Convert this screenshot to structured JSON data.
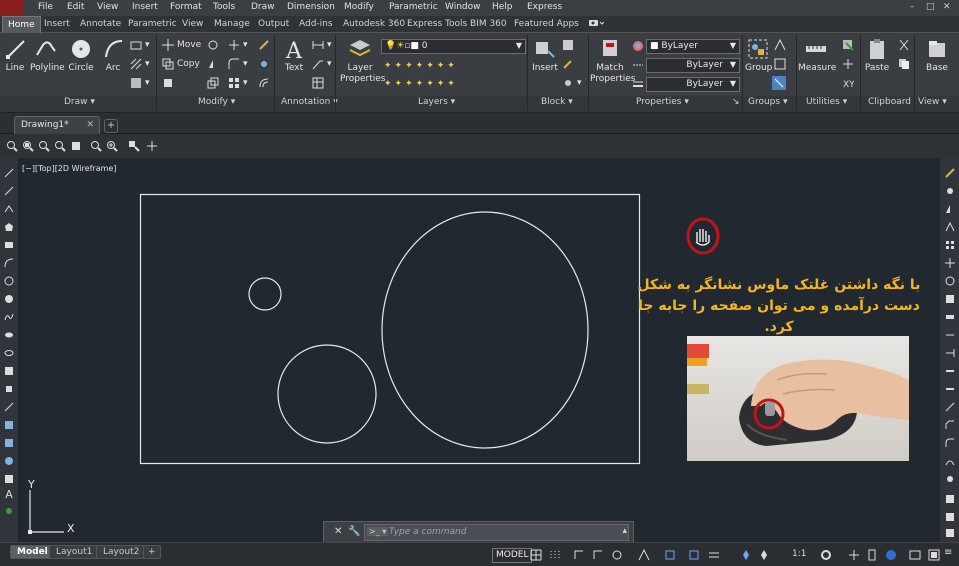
{
  "menubar": {
    "items": [
      "File",
      "Edit",
      "View",
      "Insert",
      "Format",
      "Tools",
      "Draw",
      "Dimension",
      "Modify",
      "Parametric",
      "Window",
      "Help",
      "Express"
    ],
    "window_buttons": [
      "–",
      "□",
      "✕"
    ]
  },
  "ribbon_tabs": {
    "items": [
      "Home",
      "Insert",
      "Annotate",
      "Parametric",
      "View",
      "Manage",
      "Output",
      "Add-ins",
      "Autodesk 360",
      "Express Tools",
      "BIM 360",
      "Featured Apps"
    ],
    "active": "Home"
  },
  "ribbon": {
    "draw": {
      "title": "Draw",
      "line": "Line",
      "polyline": "Polyline",
      "circle": "Circle",
      "arc": "Arc"
    },
    "modify": {
      "title": "Modify",
      "move": "Move",
      "copy": "Copy"
    },
    "annotation": {
      "title": "Annotation",
      "text": "Text"
    },
    "layers": {
      "title": "Layers",
      "layer_properties": "Layer\nProperties",
      "layer_value": "0"
    },
    "block": {
      "title": "Block",
      "insert": "Insert"
    },
    "properties": {
      "title": "Properties",
      "match_properties": "Match\nProperties",
      "color": "ByLayer",
      "linetype": "ByLayer",
      "lineweight": "ByLayer"
    },
    "groups": {
      "title": "Groups",
      "group": "Group"
    },
    "utilities": {
      "title": "Utilities",
      "measure": "Measure"
    },
    "clipboard": {
      "title": "Clipboard",
      "paste": "Paste"
    },
    "view": {
      "title": "View",
      "base": "Base"
    }
  },
  "doc_tabs": {
    "drawing": "Drawing1*",
    "new": "+"
  },
  "viewport_label": "[−][Top][2D Wireframe]",
  "overlay": {
    "tip_line1": "با نگه داشتن غلتک ماوس نشانگر به شکل",
    "tip_line2": "دست درآمده و می توان صفحه را جابه جا کرد."
  },
  "ucs": {
    "x": "X",
    "y": "Y"
  },
  "command_line": {
    "placeholder": "Type a command"
  },
  "layout_tabs": [
    "Model",
    "Layout1",
    "Layout2"
  ],
  "status": {
    "model": "MODEL",
    "scale": "1:1"
  },
  "colors": {
    "accent_text": "#f3b61f",
    "drawing_bg": "#212830",
    "line": "#e8e8e8",
    "highlight": "#c0141a"
  }
}
